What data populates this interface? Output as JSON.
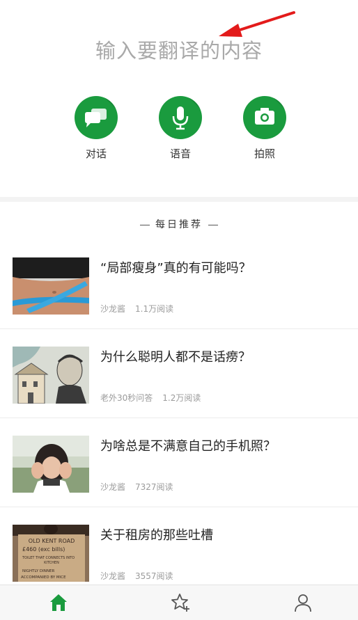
{
  "translate": {
    "input_placeholder": "输入要翻译的内容"
  },
  "modes": [
    {
      "label": "对话",
      "icon": "chat-bubbles-icon"
    },
    {
      "label": "语音",
      "icon": "microphone-icon"
    },
    {
      "label": "拍照",
      "icon": "camera-icon"
    }
  ],
  "daily": {
    "title": "每日推荐"
  },
  "articles": [
    {
      "title": "“局部瘦身”真的有可能吗？",
      "author": "沙龙酱",
      "reads": "1.1万阅读"
    },
    {
      "title": "为什么聪明人都不是话痨？",
      "author": "老外30秒问答",
      "reads": "1.2万阅读"
    },
    {
      "title": "为啥总是不满意自己的手机照？",
      "author": "沙龙酱",
      "reads": "7327阅读"
    },
    {
      "title": "关于租房的那些吐槽",
      "author": "沙龙酱",
      "reads": "3557阅读"
    }
  ],
  "thumb4_sign": [
    "OLD KENT ROAD",
    "£460 (exc bills)",
    "TOILET THAT CONNECTS INTO",
    "KITCHEN",
    "NIGHTLY DINNER",
    "ACCOMPANIED BY MICE"
  ],
  "tabbar": [
    {
      "icon": "home-icon"
    },
    {
      "icon": "star-add-icon"
    },
    {
      "icon": "profile-icon"
    }
  ],
  "colors": {
    "accent": "#1a9b3e",
    "annotation_arrow": "#e31b1b"
  }
}
